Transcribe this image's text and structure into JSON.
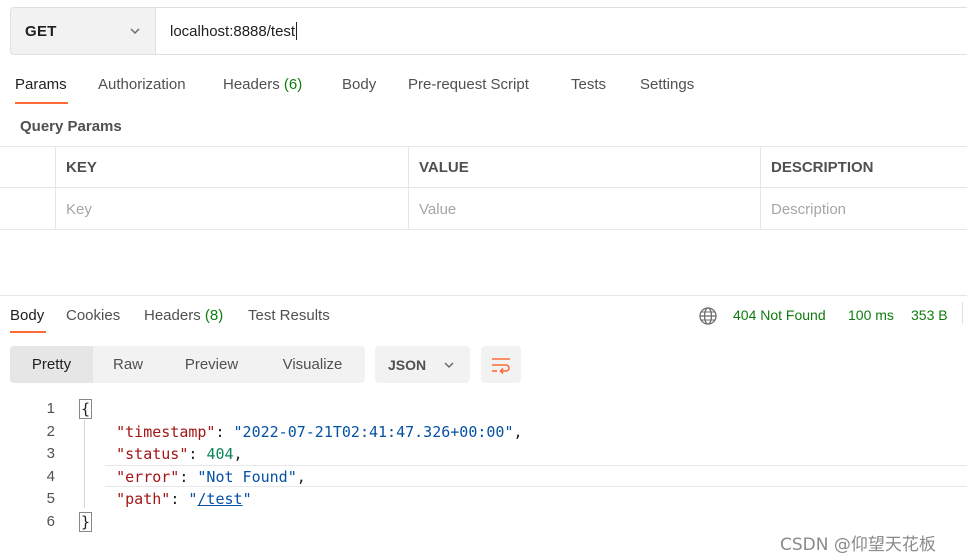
{
  "request": {
    "method": "GET",
    "url": "localhost:8888/test"
  },
  "request_tabs": [
    {
      "label": "Params"
    },
    {
      "label": "Authorization"
    },
    {
      "label": "Headers",
      "count": "(6)"
    },
    {
      "label": "Body"
    },
    {
      "label": "Pre-request Script"
    },
    {
      "label": "Tests"
    },
    {
      "label": "Settings"
    }
  ],
  "query_params": {
    "title": "Query Params",
    "columns": [
      "KEY",
      "VALUE",
      "DESCRIPTION"
    ],
    "placeholders": [
      "Key",
      "Value",
      "Description"
    ]
  },
  "response_tabs": [
    {
      "label": "Body"
    },
    {
      "label": "Cookies"
    },
    {
      "label": "Headers",
      "count": "(8)"
    },
    {
      "label": "Test Results"
    }
  ],
  "response_meta": {
    "status": "404 Not Found",
    "time": "100 ms",
    "size": "353 B"
  },
  "view_modes": [
    "Pretty",
    "Raw",
    "Preview",
    "Visualize"
  ],
  "format": "JSON",
  "code": {
    "line_numbers": [
      "1",
      "2",
      "3",
      "4",
      "5",
      "6"
    ],
    "open_brace": "{",
    "close_brace": "}",
    "fields": [
      {
        "key": "\"timestamp\"",
        "value": "\"2022-07-21T02:41:47.326+00:00\""
      },
      {
        "key": "\"status\"",
        "value": "404"
      },
      {
        "key": "\"error\"",
        "value": "\"Not Found\""
      },
      {
        "key": "\"path\"",
        "value_open": "\"",
        "value_link": "/test",
        "value_close": "\""
      }
    ]
  },
  "watermark": "CSDN @仰望天花板",
  "colors": {
    "accent": "#ff6c37",
    "success_green": "#0f7b0f",
    "json_key": "#a31515",
    "json_string": "#0451a5",
    "json_number": "#098658"
  }
}
